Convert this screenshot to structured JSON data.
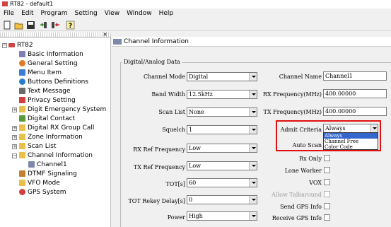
{
  "window": {
    "title": "RT82 - default1"
  },
  "menu": [
    "File",
    "Edit",
    "Program",
    "Setting",
    "View",
    "Window",
    "Help"
  ],
  "toolbar": {
    "icons": [
      "new-file-icon",
      "open-folder-icon",
      "save-icon",
      "read-radio-icon",
      "write-radio-icon",
      "about-icon"
    ]
  },
  "tree": {
    "root": "RT82",
    "items": [
      {
        "label": "Basic Information",
        "icon": "info-icon",
        "color": "#7f7fb8"
      },
      {
        "label": "General Setting",
        "icon": "gear-icon",
        "color": "#e07b2a"
      },
      {
        "label": "Menu Item",
        "icon": "menu-icon",
        "color": "#3a7bd5"
      },
      {
        "label": "Buttons Definitions",
        "icon": "buttons-icon",
        "color": "#2a7bd5"
      },
      {
        "label": "Text Message",
        "icon": "pen-icon",
        "color": "#6b6b6b"
      },
      {
        "label": "Privacy Setting",
        "icon": "key-icon",
        "color": "#d04040"
      },
      {
        "label": "Digit Emergency System",
        "icon": "folder-icon",
        "color": "#e8c04a"
      },
      {
        "label": "Digital Contact",
        "icon": "contact-icon",
        "color": "#5a9a3a"
      },
      {
        "label": "Digital RX Group Call",
        "icon": "folder-icon",
        "color": "#e8c04a"
      },
      {
        "label": "Zone Information",
        "icon": "folder-icon",
        "color": "#e8c04a"
      },
      {
        "label": "Scan List",
        "icon": "folder-icon",
        "color": "#e8c04a"
      },
      {
        "label": "Channel Information",
        "icon": "folder-open-icon",
        "color": "#e8c04a"
      },
      {
        "label": "Channel1",
        "icon": "channel-icon",
        "color": "#7a8aa8"
      },
      {
        "label": "DTMF Signaling",
        "icon": "dtmf-icon",
        "color": "#c08030"
      },
      {
        "label": "VFO Mode",
        "icon": "folder-icon",
        "color": "#e8c04a"
      },
      {
        "label": "GPS System",
        "icon": "gps-icon",
        "color": "#d04040"
      }
    ]
  },
  "content": {
    "header": "Channel Information",
    "group_label": "Digital/Analog Data",
    "channel_mode": {
      "label": "Channel Mode",
      "value": "Digital"
    },
    "band_width": {
      "label": "Band Width",
      "value": "12.5kHz"
    },
    "scan_list": {
      "label": "Scan List",
      "value": "None"
    },
    "squelch": {
      "label": "Squelch",
      "value": "1"
    },
    "rx_ref_freq": {
      "label": "RX Ref Frequency",
      "value": "Low"
    },
    "tx_ref_freq": {
      "label": "TX Ref Frequency",
      "value": "Low"
    },
    "tot": {
      "label": "TOT[s]",
      "value": "60"
    },
    "tot_rekey": {
      "label": "TOT Rekey Delay[s]",
      "value": "0"
    },
    "power": {
      "label": "Power",
      "value": "High"
    },
    "channel_name": {
      "label": "Channel Name",
      "value": "Channel1"
    },
    "rx_freq": {
      "label": "RX Frequency(MHz)",
      "value": "400.00000"
    },
    "tx_freq": {
      "label": "TX Frequency(MHz)",
      "value": "400.00000"
    },
    "admit_criteria": {
      "label": "Admit Criteria",
      "value": "Always",
      "options": [
        "Always",
        "Channel Free",
        "Color Code"
      ]
    },
    "auto_scan": {
      "label": "Auto Scan"
    },
    "rx_only": {
      "label": "Rx Only"
    },
    "lone_worker": {
      "label": "Lone Worker"
    },
    "vox": {
      "label": "VOX"
    },
    "allow_talkaround": {
      "label": "Allow Talkaround"
    },
    "send_gps": {
      "label": "Send GPS Info"
    },
    "receive_gps": {
      "label": "Receive GPS Info"
    }
  },
  "colors": {
    "highlight": "#3366cc",
    "annotation_box": "#e01010"
  }
}
